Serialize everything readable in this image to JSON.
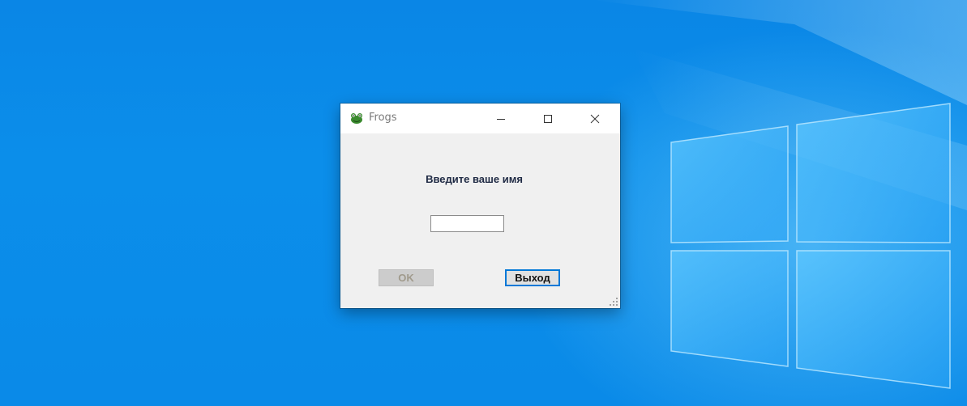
{
  "desktop": {
    "background_color": "#0a8ae8",
    "logo": "windows-logo"
  },
  "window": {
    "title": "Frogs",
    "app_icon": "frog-icon",
    "caption_buttons": {
      "minimize": "minimize-icon",
      "maximize": "maximize-icon",
      "close": "close-icon"
    },
    "prompt_label": "Введите ваше имя",
    "name_input": {
      "value": "",
      "placeholder": ""
    },
    "ok_button_label": "OK",
    "ok_button_enabled": false,
    "exit_button_label": "Выход",
    "accent_color": "#0078d7"
  }
}
